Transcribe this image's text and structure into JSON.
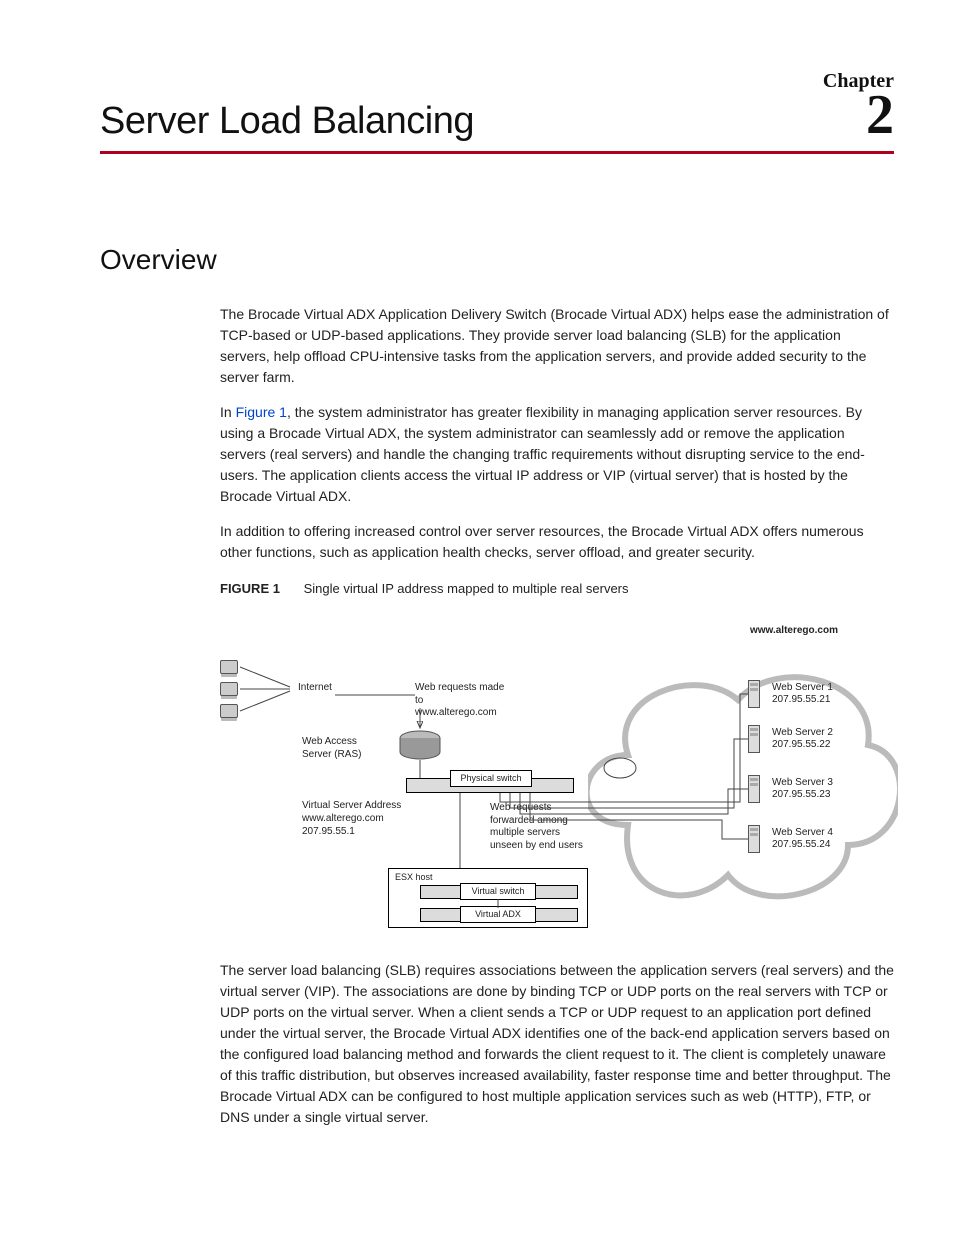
{
  "chapter": {
    "label": "Chapter",
    "number": "2",
    "title": "Server Load Balancing"
  },
  "section": {
    "heading": "Overview"
  },
  "paragraphs": {
    "p1": "The Brocade Virtual ADX Application Delivery Switch (Brocade Virtual ADX) helps ease the administration of TCP-based or UDP-based applications. They provide server load balancing (SLB) for the application servers, help offload CPU-intensive tasks from the application servers, and provide added security to the server farm.",
    "p2a": "In ",
    "p2link": "Figure 1",
    "p2b": ", the system administrator has greater flexibility in managing application server resources. By using a Brocade Virtual ADX, the system administrator can seamlessly add or remove the application servers (real servers) and handle the changing traffic requirements without disrupting service to the end-users. The application clients access the virtual IP address or VIP (virtual server) that is hosted by the Brocade Virtual ADX.",
    "p3": "In addition to offering increased control over server resources, the Brocade Virtual ADX offers numerous other functions, such as application health checks, server offload, and greater security.",
    "p4": "The server load balancing (SLB) requires associations between the application servers (real servers) and the virtual server (VIP). The associations are done by binding TCP or UDP ports on the real servers with TCP or UDP ports on the virtual server. When a client sends a TCP or UDP request to an application port defined under the virtual server, the Brocade Virtual ADX identifies one of the back-end application servers based on the configured load balancing method and forwards the client request to it. The client is completely unaware of this traffic distribution, but observes increased availability, faster response time and better throughput. The Brocade Virtual ADX can be configured to host multiple application services such as web (HTTP), FTP, or DNS under a single virtual server."
  },
  "figure": {
    "label": "FIGURE 1",
    "caption": "Single virtual IP address mapped to multiple real servers",
    "domain": "www.alterego.com",
    "internet": "Internet",
    "req1": "Web requests made to www.alterego.com",
    "ras": "Web Access Server (RAS)",
    "phys": "Physical switch",
    "vsa_label": "Virtual Server Address",
    "vsa_host": "www.alterego.com",
    "vsa_ip": "207.95.55.1",
    "req2": "Web requests forwarded among multiple servers unseen by end users",
    "esx": "ESX host",
    "vswitch": "Virtual switch",
    "vadx": "Virtual ADX",
    "servers": {
      "s1": {
        "name": "Web Server 1",
        "ip": "207.95.55.21"
      },
      "s2": {
        "name": "Web Server 2",
        "ip": "207.95.55.22"
      },
      "s3": {
        "name": "Web Server 3",
        "ip": "207.95.55.23"
      },
      "s4": {
        "name": "Web Server 4",
        "ip": "207.95.55.24"
      }
    }
  }
}
